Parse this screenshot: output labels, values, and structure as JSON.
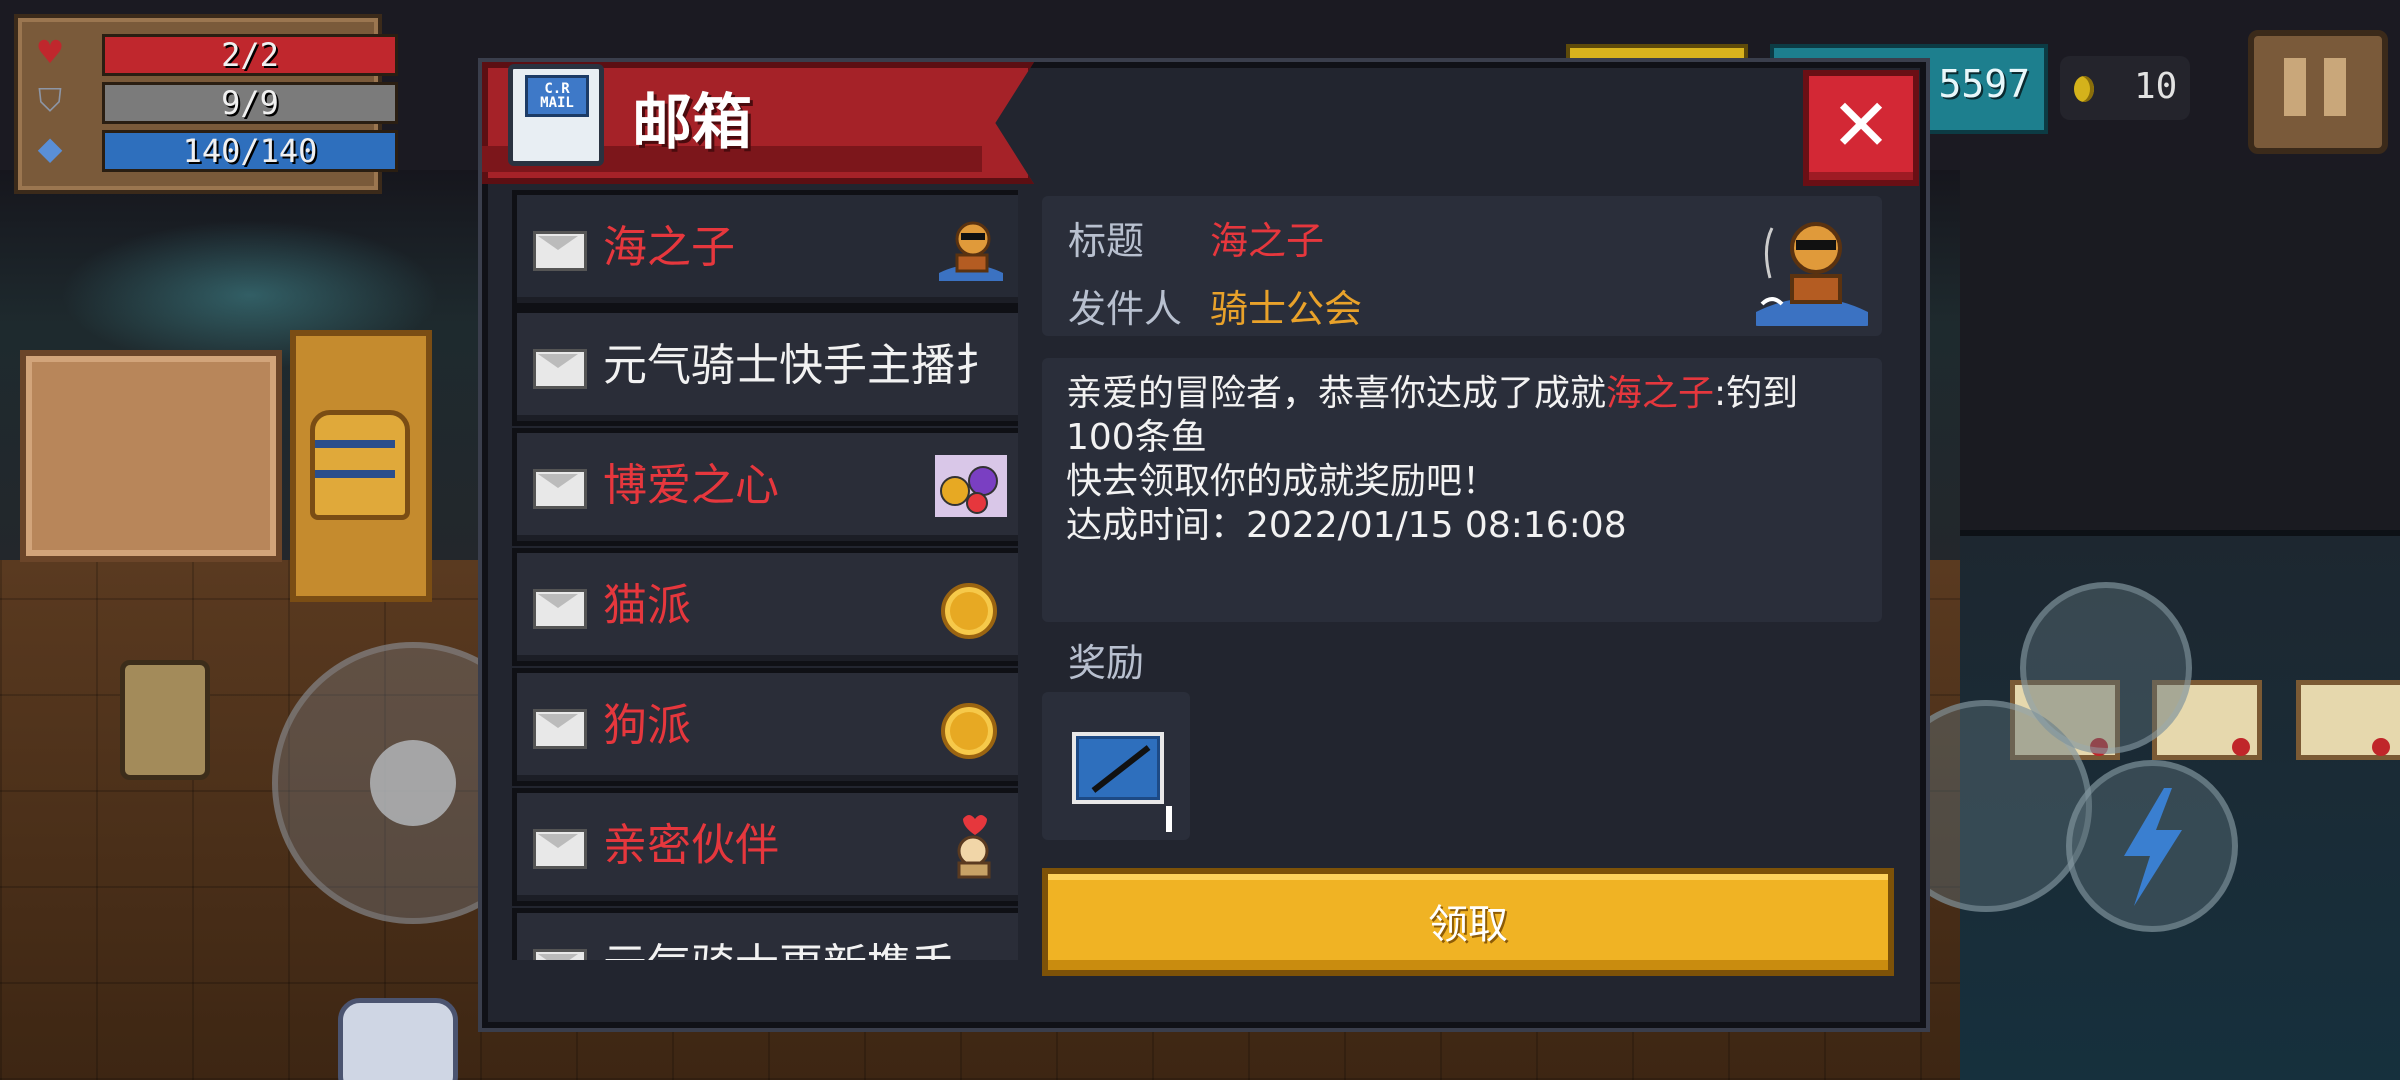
{
  "hud": {
    "health": {
      "text": "2/2",
      "fill": 1.0,
      "color": "#c0272d",
      "icon": "heart-icon"
    },
    "armor": {
      "text": "9/9",
      "fill": 1.0,
      "color": "#7b7b7b",
      "icon": "shield-icon"
    },
    "energy": {
      "text": "140/140",
      "fill": 1.0,
      "color": "#2e6fbd",
      "icon": "diamond-icon"
    },
    "gems": "5597",
    "coins": "10"
  },
  "mailbox": {
    "title": "邮箱",
    "logo_text": "C.R\nMAIL",
    "close_symbol": "✕",
    "list": [
      {
        "label": "海之子",
        "color": "red",
        "thumb": "fisher-monkey"
      },
      {
        "label": "元气骑士快手主播扌",
        "color": "white",
        "thumb": "none"
      },
      {
        "label": "博爱之心",
        "color": "red",
        "thumb": "pets-group"
      },
      {
        "label": "猫派",
        "color": "red",
        "thumb": "gold-coin"
      },
      {
        "label": "狗派",
        "color": "red",
        "thumb": "gold-coin"
      },
      {
        "label": "亲密伙伴",
        "color": "red",
        "thumb": "companion"
      },
      {
        "label": "元气骑士更新携手",
        "color": "white",
        "thumb": "none"
      }
    ],
    "detail": {
      "title_label": "标题",
      "title_value": "海之子",
      "sender_label": "发件人",
      "sender_value": "骑士公会",
      "body_pre": "亲爱的冒险者，恭喜你达成了成就",
      "body_highlight": "海之子",
      "body_post": ":钓到100条鱼",
      "body_line2": "快去领取你的成就奖励吧！",
      "body_line3": "达成时间：2022/01/15 08:16:08",
      "reward_label": "奖励",
      "claim_label": "领取"
    }
  },
  "colors": {
    "accent_red": "#e6373d",
    "accent_orange": "#e9a22a",
    "claim_yellow": "#f0b324",
    "banner_red": "#a52228"
  }
}
